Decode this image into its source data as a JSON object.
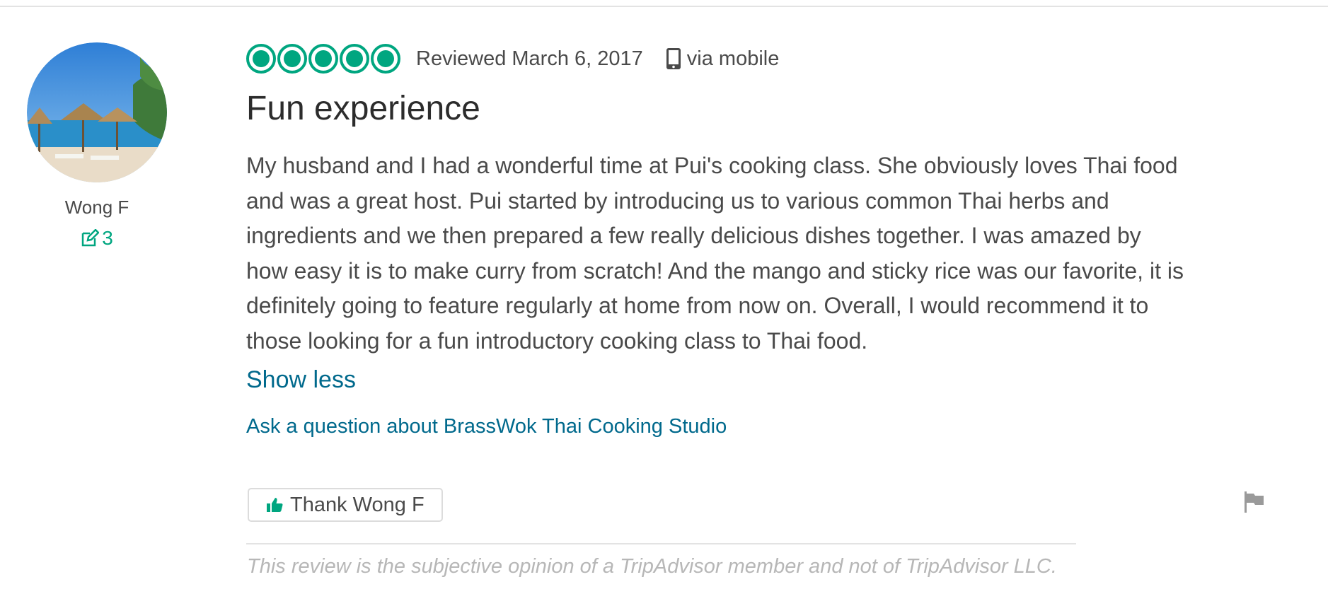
{
  "member": {
    "name": "Wong F",
    "contribution_count": "3"
  },
  "review": {
    "rating": 5,
    "rating_max": 5,
    "reviewed_date": "Reviewed March 6, 2017",
    "via": "via mobile",
    "title": "Fun experience",
    "body": "My husband and I had a wonderful time at Pui's cooking class. She obviously loves Thai food and was a great host. Pui started by introducing us to various common Thai herbs and ingredients and we then prepared a few really delicious dishes together. I was amazed by how easy it is to make curry from scratch! And the mango and sticky rice was our favorite, it is definitely going to feature regularly at home from now on. Overall, I would recommend it to those looking for a fun introductory cooking class to Thai food.",
    "show_less_label": "Show less",
    "ask_question_label": "Ask a question about BrassWok Thai Cooking Studio",
    "thank_label": "Thank Wong F",
    "disclaimer": "This review is the subjective opinion of a TripAdvisor member and not of TripAdvisor LLC."
  },
  "icons": {
    "contribution": "edit-icon",
    "device": "mobile-phone-icon",
    "thank": "thumbs-up-icon",
    "report": "flag-icon"
  },
  "colors": {
    "accent_green": "#00a680",
    "link_blue": "#00698c",
    "text": "#4a4a4a",
    "muted": "#b7b7b7"
  }
}
